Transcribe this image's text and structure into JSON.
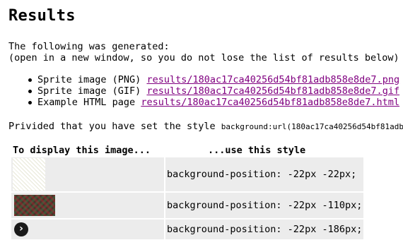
{
  "page": {
    "heading": "Results",
    "intro_line1": "The following was generated:",
    "intro_line2": "(open in a new window, so you do not lose the list of results below)"
  },
  "links": [
    {
      "label": "Sprite image (PNG)",
      "href_text": "results/180ac17ca40256d54bf81adb858e8de7.png"
    },
    {
      "label": "Sprite image (GIF)",
      "href_text": "results/180ac17ca40256d54bf81adb858e8de7.gif"
    },
    {
      "label": "Example HTML page",
      "href_text": "results/180ac17ca40256d54bf81adb858e8de7.html"
    }
  ],
  "style_note": {
    "text": "Privided that you have set the style",
    "code": "background:url(180ac17ca40256d54bf81adb"
  },
  "table": {
    "col1_header": "To display this image...",
    "col2_header": "...use this style",
    "rows": [
      {
        "icon": "hatch-pattern-image",
        "style": "background-position: -22px -22px;"
      },
      {
        "icon": "textured-pattern-image",
        "style": "background-position: -22px -110px;"
      },
      {
        "icon": "arrow-circle-icon",
        "style": "background-position: -22px -186px;"
      }
    ]
  },
  "colors": {
    "link_visited": "#800080",
    "cell_bg": "#ececec"
  }
}
